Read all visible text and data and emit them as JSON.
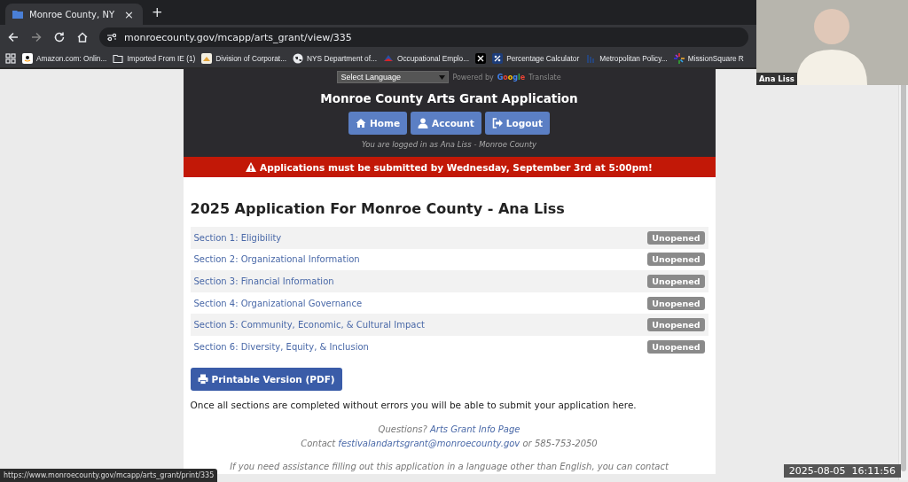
{
  "browser": {
    "tab": {
      "title": "Monroe County, NY",
      "close": "×"
    },
    "new_tab": "+",
    "address": "monroecounty.gov/mcapp/arts_grant/view/335",
    "bookmarks": [
      {
        "label": "Amazon.com: Onlin...",
        "kind": "amazon"
      },
      {
        "label": "Imported From IE (1)",
        "kind": "folder"
      },
      {
        "label": "Division of Corporat...",
        "kind": "site"
      },
      {
        "label": "NYS Department of...",
        "kind": "globe"
      },
      {
        "label": "Occupational Emplo...",
        "kind": "flag"
      },
      {
        "kind": "x"
      },
      {
        "label": "Percentage Calculator",
        "kind": "percent"
      },
      {
        "label": "Metropolitan Policy...",
        "kind": "bars"
      },
      {
        "label": "MissionSquare R",
        "kind": "burst"
      }
    ]
  },
  "header": {
    "language_select": "Select Language",
    "powered_by": "Powered by",
    "google": "Google",
    "translate": "Translate",
    "title": "Monroe County Arts Grant Application",
    "nav_buttons": [
      {
        "label": "Home"
      },
      {
        "label": "Account"
      },
      {
        "label": "Logout"
      }
    ],
    "login_note": "You are logged in as Ana Liss - Monroe County"
  },
  "alert": "Applications must be submitted by Wednesday, September 3rd at 5:00pm!",
  "heading": "2025 Application For Monroe County - Ana Liss",
  "sections": [
    {
      "label": "Section 1: Eligibility",
      "status": "Unopened"
    },
    {
      "label": "Section 2: Organizational Information",
      "status": "Unopened"
    },
    {
      "label": "Section 3: Financial Information",
      "status": "Unopened"
    },
    {
      "label": "Section 4: Organizational Governance",
      "status": "Unopened"
    },
    {
      "label": "Section 5: Community, Economic, & Cultural Impact",
      "status": "Unopened"
    },
    {
      "label": "Section 6: Diversity, Equity, & Inclusion",
      "status": "Unopened"
    }
  ],
  "print_button": "Printable Version (PDF)",
  "submit_note": "Once all sections are completed without errors you will be able to submit your application here.",
  "questions": {
    "label": "Questions?",
    "link": "Arts Grant Info Page"
  },
  "contact": {
    "label": "Contact",
    "email": "festivalandartsgrant@monroecounty.gov",
    "rest": "or 585-753-2050"
  },
  "assistance": "If you need assistance filling out this application in a language other than English, you can contact",
  "status_tooltip": "https://www.monroecounty.gov/mcapp/arts_grant/print/335",
  "video": {
    "name_tag": "Ana Liss"
  },
  "timestamp": "2025-08-05  16:11:56"
}
